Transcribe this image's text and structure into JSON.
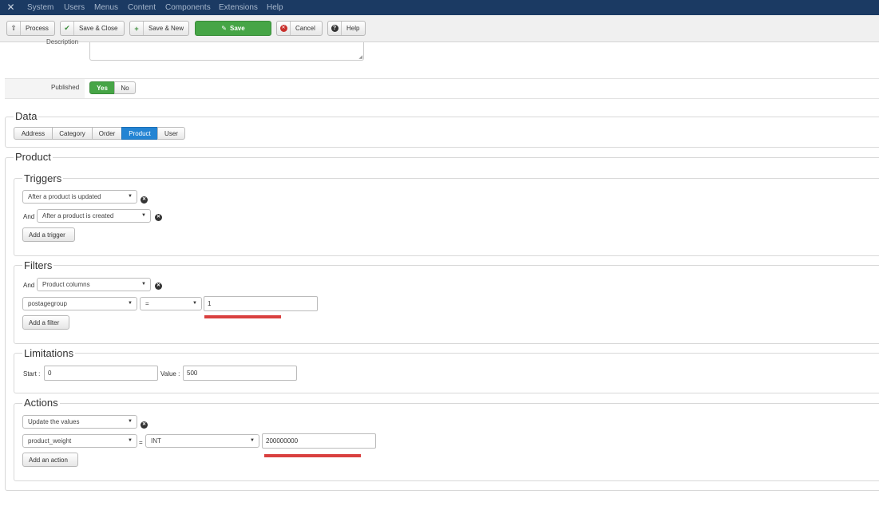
{
  "topnav": {
    "items": [
      "System",
      "Users",
      "Menus",
      "Content",
      "Components",
      "Extensions",
      "Help"
    ]
  },
  "toolbar": {
    "process": "Process",
    "save_close": "Save & Close",
    "save_new": "Save & New",
    "save": "Save",
    "cancel": "Cancel",
    "help": "Help"
  },
  "form": {
    "description_label": "Description",
    "published_label": "Published",
    "published_yes": "Yes",
    "published_no": "No"
  },
  "data_section": {
    "legend": "Data",
    "tabs": [
      "Address",
      "Category",
      "Order",
      "Product",
      "User"
    ],
    "active_tab": "Product"
  },
  "product": {
    "legend": "Product",
    "triggers": {
      "legend": "Triggers",
      "trigger1": "After a product is updated",
      "and_label": "And",
      "trigger2": "After a product is created",
      "add_button": "Add a trigger"
    },
    "filters": {
      "legend": "Filters",
      "and_label": "And",
      "filter_type": "Product columns",
      "column": "postagegroup",
      "operator": "=",
      "value": "1",
      "add_button": "Add a filter"
    },
    "limitations": {
      "legend": "Limitations",
      "start_label": "Start :",
      "start_value": "0",
      "value_label": "Value :",
      "value_value": "500"
    },
    "actions": {
      "legend": "Actions",
      "action_type": "Update the values",
      "column": "product_weight",
      "equals": "=",
      "value_type": "INT",
      "value": "200000000",
      "add_button": "Add an action"
    }
  },
  "colors": {
    "nav_bg": "#1b3a63",
    "save_green": "#46a546",
    "active_blue": "#2384d3",
    "highlight_red": "#d9403f"
  }
}
